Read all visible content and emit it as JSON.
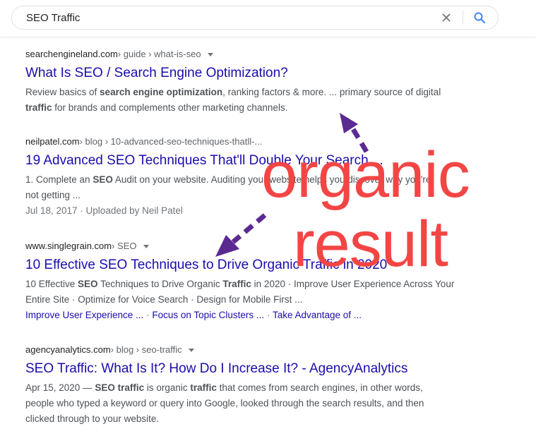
{
  "search": {
    "query": "SEO Traffic",
    "clear_icon": "close-icon",
    "search_icon": "search-icon"
  },
  "results": [
    {
      "domain": "searchengineland.com",
      "path": " › guide › what-is-seo",
      "title": "What Is SEO / Search Engine Optimization?",
      "snippet_parts": [
        {
          "t": "Review basics of ",
          "b": false
        },
        {
          "t": "search engine optimization",
          "b": true
        },
        {
          "t": ", ranking factors & more. ... primary source of digital ",
          "b": false
        },
        {
          "t": "traffic",
          "b": true
        },
        {
          "t": " for brands and complements other marketing channels.",
          "b": false
        }
      ]
    },
    {
      "domain": "neilpatel.com",
      "path": " › blog › 10-advanced-seo-techniques-thatll-...",
      "title": "19 Advanced SEO Techniques That'll Double Your Search ...",
      "snippet_parts": [
        {
          "t": "1. Complete an ",
          "b": false
        },
        {
          "t": "SEO",
          "b": true
        },
        {
          "t": " Audit on your website. Auditing your website helps you discover why you're not getting ...",
          "b": false
        }
      ],
      "meta": "Jul 18, 2017 · Uploaded by Neil Patel"
    },
    {
      "domain": "www.singlegrain.com",
      "path": " › SEO",
      "title": "10 Effective SEO Techniques to Drive Organic Traffic in 2020",
      "snippet_parts": [
        {
          "t": "10 Effective ",
          "b": false
        },
        {
          "t": "SEO",
          "b": true
        },
        {
          "t": " Techniques to Drive Organic ",
          "b": false
        },
        {
          "t": "Traffic",
          "b": true
        },
        {
          "t": " in 2020 · Improve User Experience Across Your Entire Site · Optimize for Voice Search · Design for Mobile First ...",
          "b": false
        }
      ],
      "sitelinks": [
        "Improve User Experience ...",
        "Focus on Topic Clusters ...",
        "Take Advantage of ..."
      ]
    },
    {
      "domain": "agencyanalytics.com",
      "path": " › blog › seo-traffic",
      "title": "SEO Traffic: What Is It? How Do I Increase It? - AgencyAnalytics",
      "snippet_parts": [
        {
          "t": "Apr 15, 2020 — ",
          "b": false
        },
        {
          "t": "SEO traffic",
          "b": true
        },
        {
          "t": " is organic ",
          "b": false
        },
        {
          "t": "traffic",
          "b": true
        },
        {
          "t": " that comes from search engines, in other words, people who typed a keyword or query into Google, looked through the search results, and then clicked through to your website.",
          "b": false
        }
      ]
    }
  ],
  "annotation": {
    "line1": "organic",
    "line2": "result",
    "color": "#f44545",
    "arrow_color": "#5b2a91"
  },
  "colors": {
    "link": "#1a0dab",
    "text": "#4d5156",
    "accent": "#4285f4"
  }
}
